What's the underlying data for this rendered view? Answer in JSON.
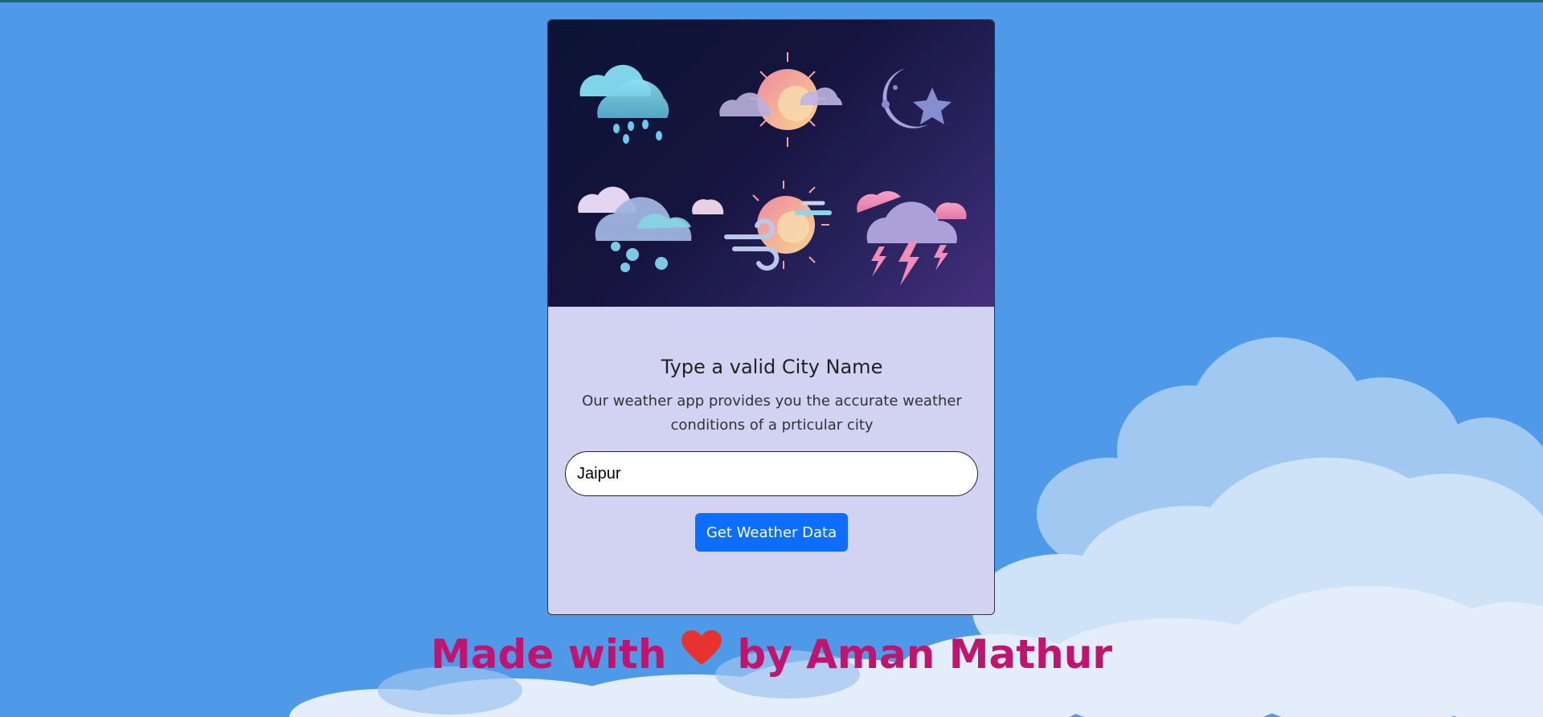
{
  "card": {
    "title": "Type a valid City Name",
    "description": "Our weather app provides you the accurate weather conditions of a prticular city"
  },
  "search": {
    "value": "Jaipur"
  },
  "actions": {
    "get_weather_label": "Get Weather Data"
  },
  "footer": {
    "prefix": "Made with",
    "suffix": "by Aman Mathur",
    "icon": "heart-icon"
  },
  "colors": {
    "page_background": "#4e9ae8",
    "card_background": "#d2d2f2",
    "button": "#0d6efd",
    "footer_text": "#c0146e",
    "heart": "#e8322f"
  },
  "icons": [
    "rain-cloud-icon",
    "sun-cloud-icon",
    "moon-star-icon",
    "hail-cloud-icon",
    "windy-sun-icon",
    "thunderstorm-cloud-icon"
  ]
}
